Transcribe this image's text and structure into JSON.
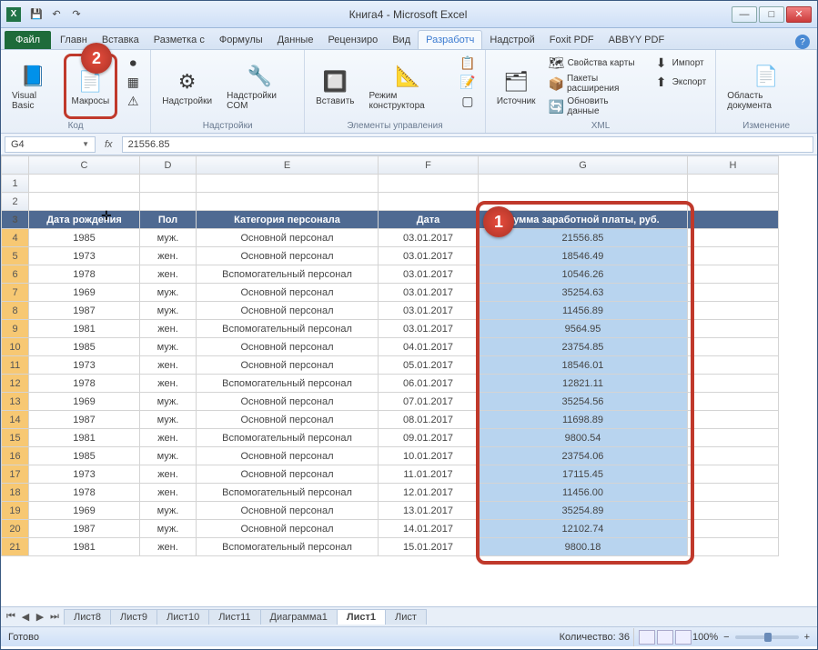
{
  "app": {
    "title": "Книга4 - Microsoft Excel"
  },
  "tabs": {
    "file": "Файл",
    "items": [
      "Главн",
      "Вставка",
      "Разметка с",
      "Формулы",
      "Данные",
      "Рецензиро",
      "Вид",
      "Разработч",
      "Надстрой",
      "Foxit PDF",
      "ABBYY PDF"
    ],
    "active_index": 7
  },
  "ribbon": {
    "code_group": "Код",
    "visual_basic": "Visual Basic",
    "macros": "Макросы",
    "addins_group": "Надстройки",
    "addins": "Надстройки",
    "com_addins": "Надстройки COM",
    "controls_group": "Элементы управления",
    "insert": "Вставить",
    "design_mode": "Режим конструктора",
    "xml_group": "XML",
    "source": "Источник",
    "map_props": "Свойства карты",
    "exp_packs": "Пакеты расширения",
    "refresh": "Обновить данные",
    "import": "Импорт",
    "export": "Экспорт",
    "modify_group": "Изменение",
    "doc_panel": "Область документа"
  },
  "formula": {
    "namebox": "G4",
    "fx": "fx",
    "value": "21556.85"
  },
  "columns": [
    "C",
    "D",
    "E",
    "F",
    "G",
    "H"
  ],
  "header_row": [
    "Дата рождения",
    "Пол",
    "Категория персонала",
    "Дата",
    "Сумма заработной платы, руб."
  ],
  "rows": [
    {
      "n": 4,
      "c": "1985",
      "d": "муж.",
      "e": "Основной персонал",
      "f": "03.01.2017",
      "g": "21556.85"
    },
    {
      "n": 5,
      "c": "1973",
      "d": "жен.",
      "e": "Основной персонал",
      "f": "03.01.2017",
      "g": "18546.49"
    },
    {
      "n": 6,
      "c": "1978",
      "d": "жен.",
      "e": "Вспомогательный персонал",
      "f": "03.01.2017",
      "g": "10546.26"
    },
    {
      "n": 7,
      "c": "1969",
      "d": "муж.",
      "e": "Основной персонал",
      "f": "03.01.2017",
      "g": "35254.63"
    },
    {
      "n": 8,
      "c": "1987",
      "d": "муж.",
      "e": "Основной персонал",
      "f": "03.01.2017",
      "g": "11456.89"
    },
    {
      "n": 9,
      "c": "1981",
      "d": "жен.",
      "e": "Вспомогательный персонал",
      "f": "03.01.2017",
      "g": "9564.95"
    },
    {
      "n": 10,
      "c": "1985",
      "d": "муж.",
      "e": "Основной персонал",
      "f": "04.01.2017",
      "g": "23754.85"
    },
    {
      "n": 11,
      "c": "1973",
      "d": "жен.",
      "e": "Основной персонал",
      "f": "05.01.2017",
      "g": "18546.01"
    },
    {
      "n": 12,
      "c": "1978",
      "d": "жен.",
      "e": "Вспомогательный персонал",
      "f": "06.01.2017",
      "g": "12821.11"
    },
    {
      "n": 13,
      "c": "1969",
      "d": "муж.",
      "e": "Основной персонал",
      "f": "07.01.2017",
      "g": "35254.56"
    },
    {
      "n": 14,
      "c": "1987",
      "d": "муж.",
      "e": "Основной персонал",
      "f": "08.01.2017",
      "g": "11698.89"
    },
    {
      "n": 15,
      "c": "1981",
      "d": "жен.",
      "e": "Вспомогательный персонал",
      "f": "09.01.2017",
      "g": "9800.54"
    },
    {
      "n": 16,
      "c": "1985",
      "d": "муж.",
      "e": "Основной персонал",
      "f": "10.01.2017",
      "g": "23754.06"
    },
    {
      "n": 17,
      "c": "1973",
      "d": "жен.",
      "e": "Основной персонал",
      "f": "11.01.2017",
      "g": "17115.45"
    },
    {
      "n": 18,
      "c": "1978",
      "d": "жен.",
      "e": "Вспомогательный персонал",
      "f": "12.01.2017",
      "g": "11456.00"
    },
    {
      "n": 19,
      "c": "1969",
      "d": "муж.",
      "e": "Основной персонал",
      "f": "13.01.2017",
      "g": "35254.89"
    },
    {
      "n": 20,
      "c": "1987",
      "d": "муж.",
      "e": "Основной персонал",
      "f": "14.01.2017",
      "g": "12102.74"
    },
    {
      "n": 21,
      "c": "1981",
      "d": "жен.",
      "e": "Вспомогательный персонал",
      "f": "15.01.2017",
      "g": "9800.18"
    }
  ],
  "sheets": [
    "Лист8",
    "Лист9",
    "Лист10",
    "Лист11",
    "Диаграмма1",
    "Лист1",
    "Лист"
  ],
  "active_sheet_index": 5,
  "status": {
    "ready": "Готово",
    "count_label": "Количество: 36",
    "zoom": "100%"
  },
  "callouts": {
    "one": "1",
    "two": "2"
  }
}
